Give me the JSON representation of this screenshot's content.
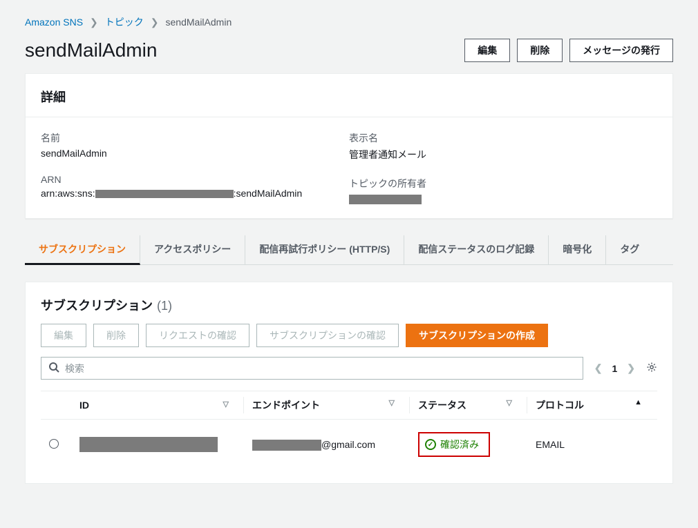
{
  "breadcrumb": {
    "root": "Amazon SNS",
    "mid": "トピック",
    "current": "sendMailAdmin"
  },
  "title": "sendMailAdmin",
  "actions": {
    "edit": "編集",
    "delete": "削除",
    "publish": "メッセージの発行"
  },
  "details": {
    "heading": "詳細",
    "name_label": "名前",
    "name_value": "sendMailAdmin",
    "arn_label": "ARN",
    "arn_prefix": "arn:aws:sns:",
    "arn_suffix": ":sendMailAdmin",
    "display_label": "表示名",
    "display_value": "管理者通知メール",
    "owner_label": "トピックの所有者"
  },
  "tabs": {
    "sub": "サブスクリプション",
    "access": "アクセスポリシー",
    "retry": "配信再試行ポリシー (HTTP/S)",
    "log": "配信ステータスのログ記録",
    "enc": "暗号化",
    "tag": "タグ"
  },
  "subsection": {
    "heading": "サブスクリプション",
    "count": "(1)",
    "btn_edit": "編集",
    "btn_delete": "削除",
    "btn_confirm_req": "リクエストの確認",
    "btn_confirm_sub": "サブスクリプションの確認",
    "btn_create": "サブスクリプションの作成",
    "search_placeholder": "検索",
    "page": "1"
  },
  "table": {
    "col_id": "ID",
    "col_endpoint": "エンドポイント",
    "col_status": "ステータス",
    "col_protocol": "プロトコル",
    "row0": {
      "endpoint_suffix": "@gmail.com",
      "status": "確認済み",
      "protocol": "EMAIL"
    }
  }
}
